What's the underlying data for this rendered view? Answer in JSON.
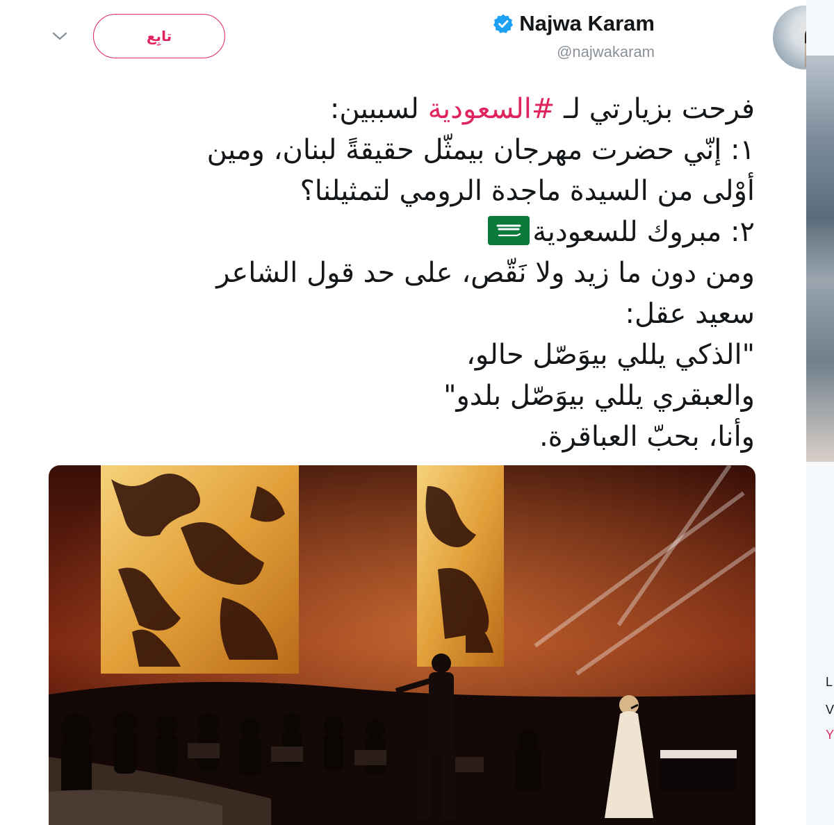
{
  "header": {
    "display_name": "Najwa Karam",
    "handle": "@najwakaram",
    "follow_label": "تابِع"
  },
  "tweet": {
    "line1_prefix": "فرحت بزيارتي لـ ",
    "hashtag": "#السعودية",
    "line1_suffix": " لسببين:",
    "line2": "١: إنّي حضرت مهرجان بيمثّل حقيقةً لبنان، ومين",
    "line3": "أوْلى من السيدة ماجدة الرومي لتمثيلنا؟",
    "line4": "٢: مبروك للسعودية",
    "line5": "ومن دون ما زيد ولا نَقّص، على حد قول الشاعر",
    "line6": "سعيد عقل:",
    "line7": "\"الذكي يللي بيوَصّل حالو،",
    "line8": "والعبقري يللي بيوَصّل بلدو\"",
    "line9": "وأنا، بحبّ العباقرة."
  },
  "icons": {
    "verified": "verified-badge-icon",
    "menu": "chevron-down-icon",
    "flag": "saudi-flag-emoji"
  },
  "colors": {
    "accent": "#e0245e",
    "verified": "#1da1f2",
    "handle": "#8a9199"
  },
  "sidebar": {
    "fragment_1": "L",
    "fragment_2": "V",
    "fragment_3": "Y"
  }
}
